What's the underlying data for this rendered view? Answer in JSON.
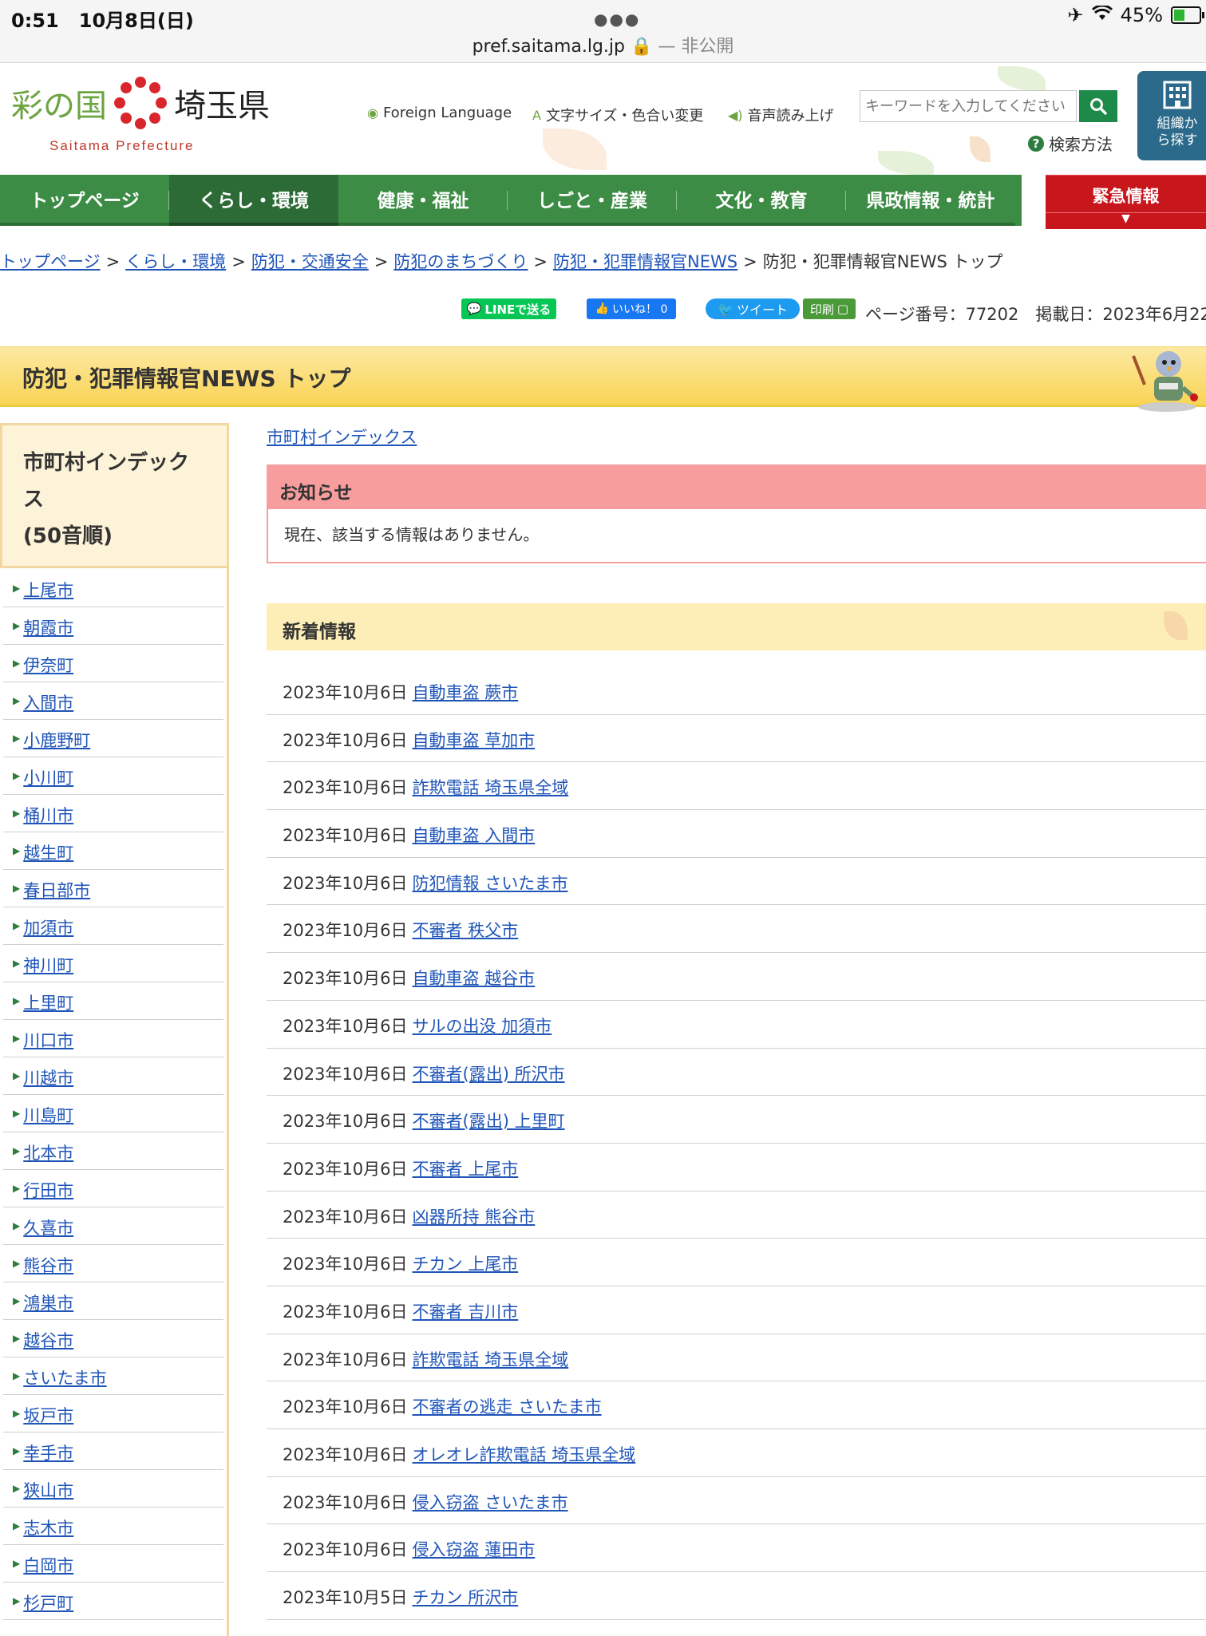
{
  "status_bar": {
    "time": "0:51",
    "date": "10月8日(日)",
    "url": "pref.saitama.lg.jp",
    "url_note": "— 非公開",
    "battery": "45%"
  },
  "header": {
    "logo_left": "彩の国",
    "logo_right": "埼玉県",
    "logo_sub": "Saitama Prefecture",
    "foreign_language": "Foreign Language",
    "text_size_color": "文字サイズ・色合い変更",
    "read_aloud": "音声読み上げ",
    "search_placeholder": "キーワードを入力してください",
    "search_help": "検索方法",
    "org_search": "組織から探す"
  },
  "nav": {
    "items": [
      "トップページ",
      "くらし・環境",
      "健康・福祉",
      "しごと・産業",
      "文化・教育",
      "県政情報・統計"
    ],
    "emergency": "緊急情報"
  },
  "breadcrumb": {
    "links": [
      "トップページ",
      "くらし・環境",
      "防犯・交通安全",
      "防犯のまちづくり",
      "防犯・犯罪情報官NEWS"
    ],
    "current": "防犯・犯罪情報官NEWS トップ"
  },
  "share": {
    "line": "LINEで送る",
    "facebook": "いいね！ 0",
    "twitter": "ツイート",
    "print": "印刷",
    "page_info": "ページ番号：77202　掲載日：2023年6月22"
  },
  "page_title": "防犯・犯罪情報官NEWS トップ",
  "sidebar": {
    "heading_line1": "市町村インデック",
    "heading_line2": "ス",
    "heading_line3": "(50音順)",
    "items": [
      "上尾市",
      "朝霞市",
      "伊奈町",
      "入間市",
      "小鹿野町",
      "小川町",
      "桶川市",
      "越生町",
      "春日部市",
      "加須市",
      "神川町",
      "上里町",
      "川口市",
      "川越市",
      "川島町",
      "北本市",
      "行田市",
      "久喜市",
      "熊谷市",
      "鴻巣市",
      "越谷市",
      "さいたま市",
      "坂戸市",
      "幸手市",
      "狭山市",
      "志木市",
      "白岡市",
      "杉戸町"
    ]
  },
  "main": {
    "index_link": "市町村インデックス",
    "notice_title": "お知らせ",
    "notice_body": "現在、該当する情報はありません。",
    "news_title": "新着情報",
    "news": [
      {
        "date": "2023年10月6日",
        "title": "自動車盗 蕨市"
      },
      {
        "date": "2023年10月6日",
        "title": "自動車盗 草加市"
      },
      {
        "date": "2023年10月6日",
        "title": "詐欺電話 埼玉県全域"
      },
      {
        "date": "2023年10月6日",
        "title": "自動車盗 入間市"
      },
      {
        "date": "2023年10月6日",
        "title": "防犯情報 さいたま市"
      },
      {
        "date": "2023年10月6日",
        "title": "不審者 秩父市"
      },
      {
        "date": "2023年10月6日",
        "title": "自動車盗 越谷市"
      },
      {
        "date": "2023年10月6日",
        "title": "サルの出没 加須市"
      },
      {
        "date": "2023年10月6日",
        "title": "不審者(露出) 所沢市"
      },
      {
        "date": "2023年10月6日",
        "title": "不審者(露出) 上里町"
      },
      {
        "date": "2023年10月6日",
        "title": "不審者 上尾市"
      },
      {
        "date": "2023年10月6日",
        "title": "凶器所持 熊谷市"
      },
      {
        "date": "2023年10月6日",
        "title": "チカン 上尾市"
      },
      {
        "date": "2023年10月6日",
        "title": "不審者 吉川市"
      },
      {
        "date": "2023年10月6日",
        "title": "詐欺電話 埼玉県全域"
      },
      {
        "date": "2023年10月6日",
        "title": "不審者の逃走 さいたま市"
      },
      {
        "date": "2023年10月6日",
        "title": "オレオレ詐欺電話 埼玉県全域"
      },
      {
        "date": "2023年10月6日",
        "title": "侵入窃盗 さいたま市"
      },
      {
        "date": "2023年10月6日",
        "title": "侵入窃盗 蓮田市"
      },
      {
        "date": "2023年10月5日",
        "title": "チカン 所沢市"
      }
    ]
  },
  "colors": {
    "nav_green": "#3c8c45",
    "emergency_red": "#c8161d",
    "title_yellow": "#f9d455",
    "link_blue": "#1f55b8"
  }
}
